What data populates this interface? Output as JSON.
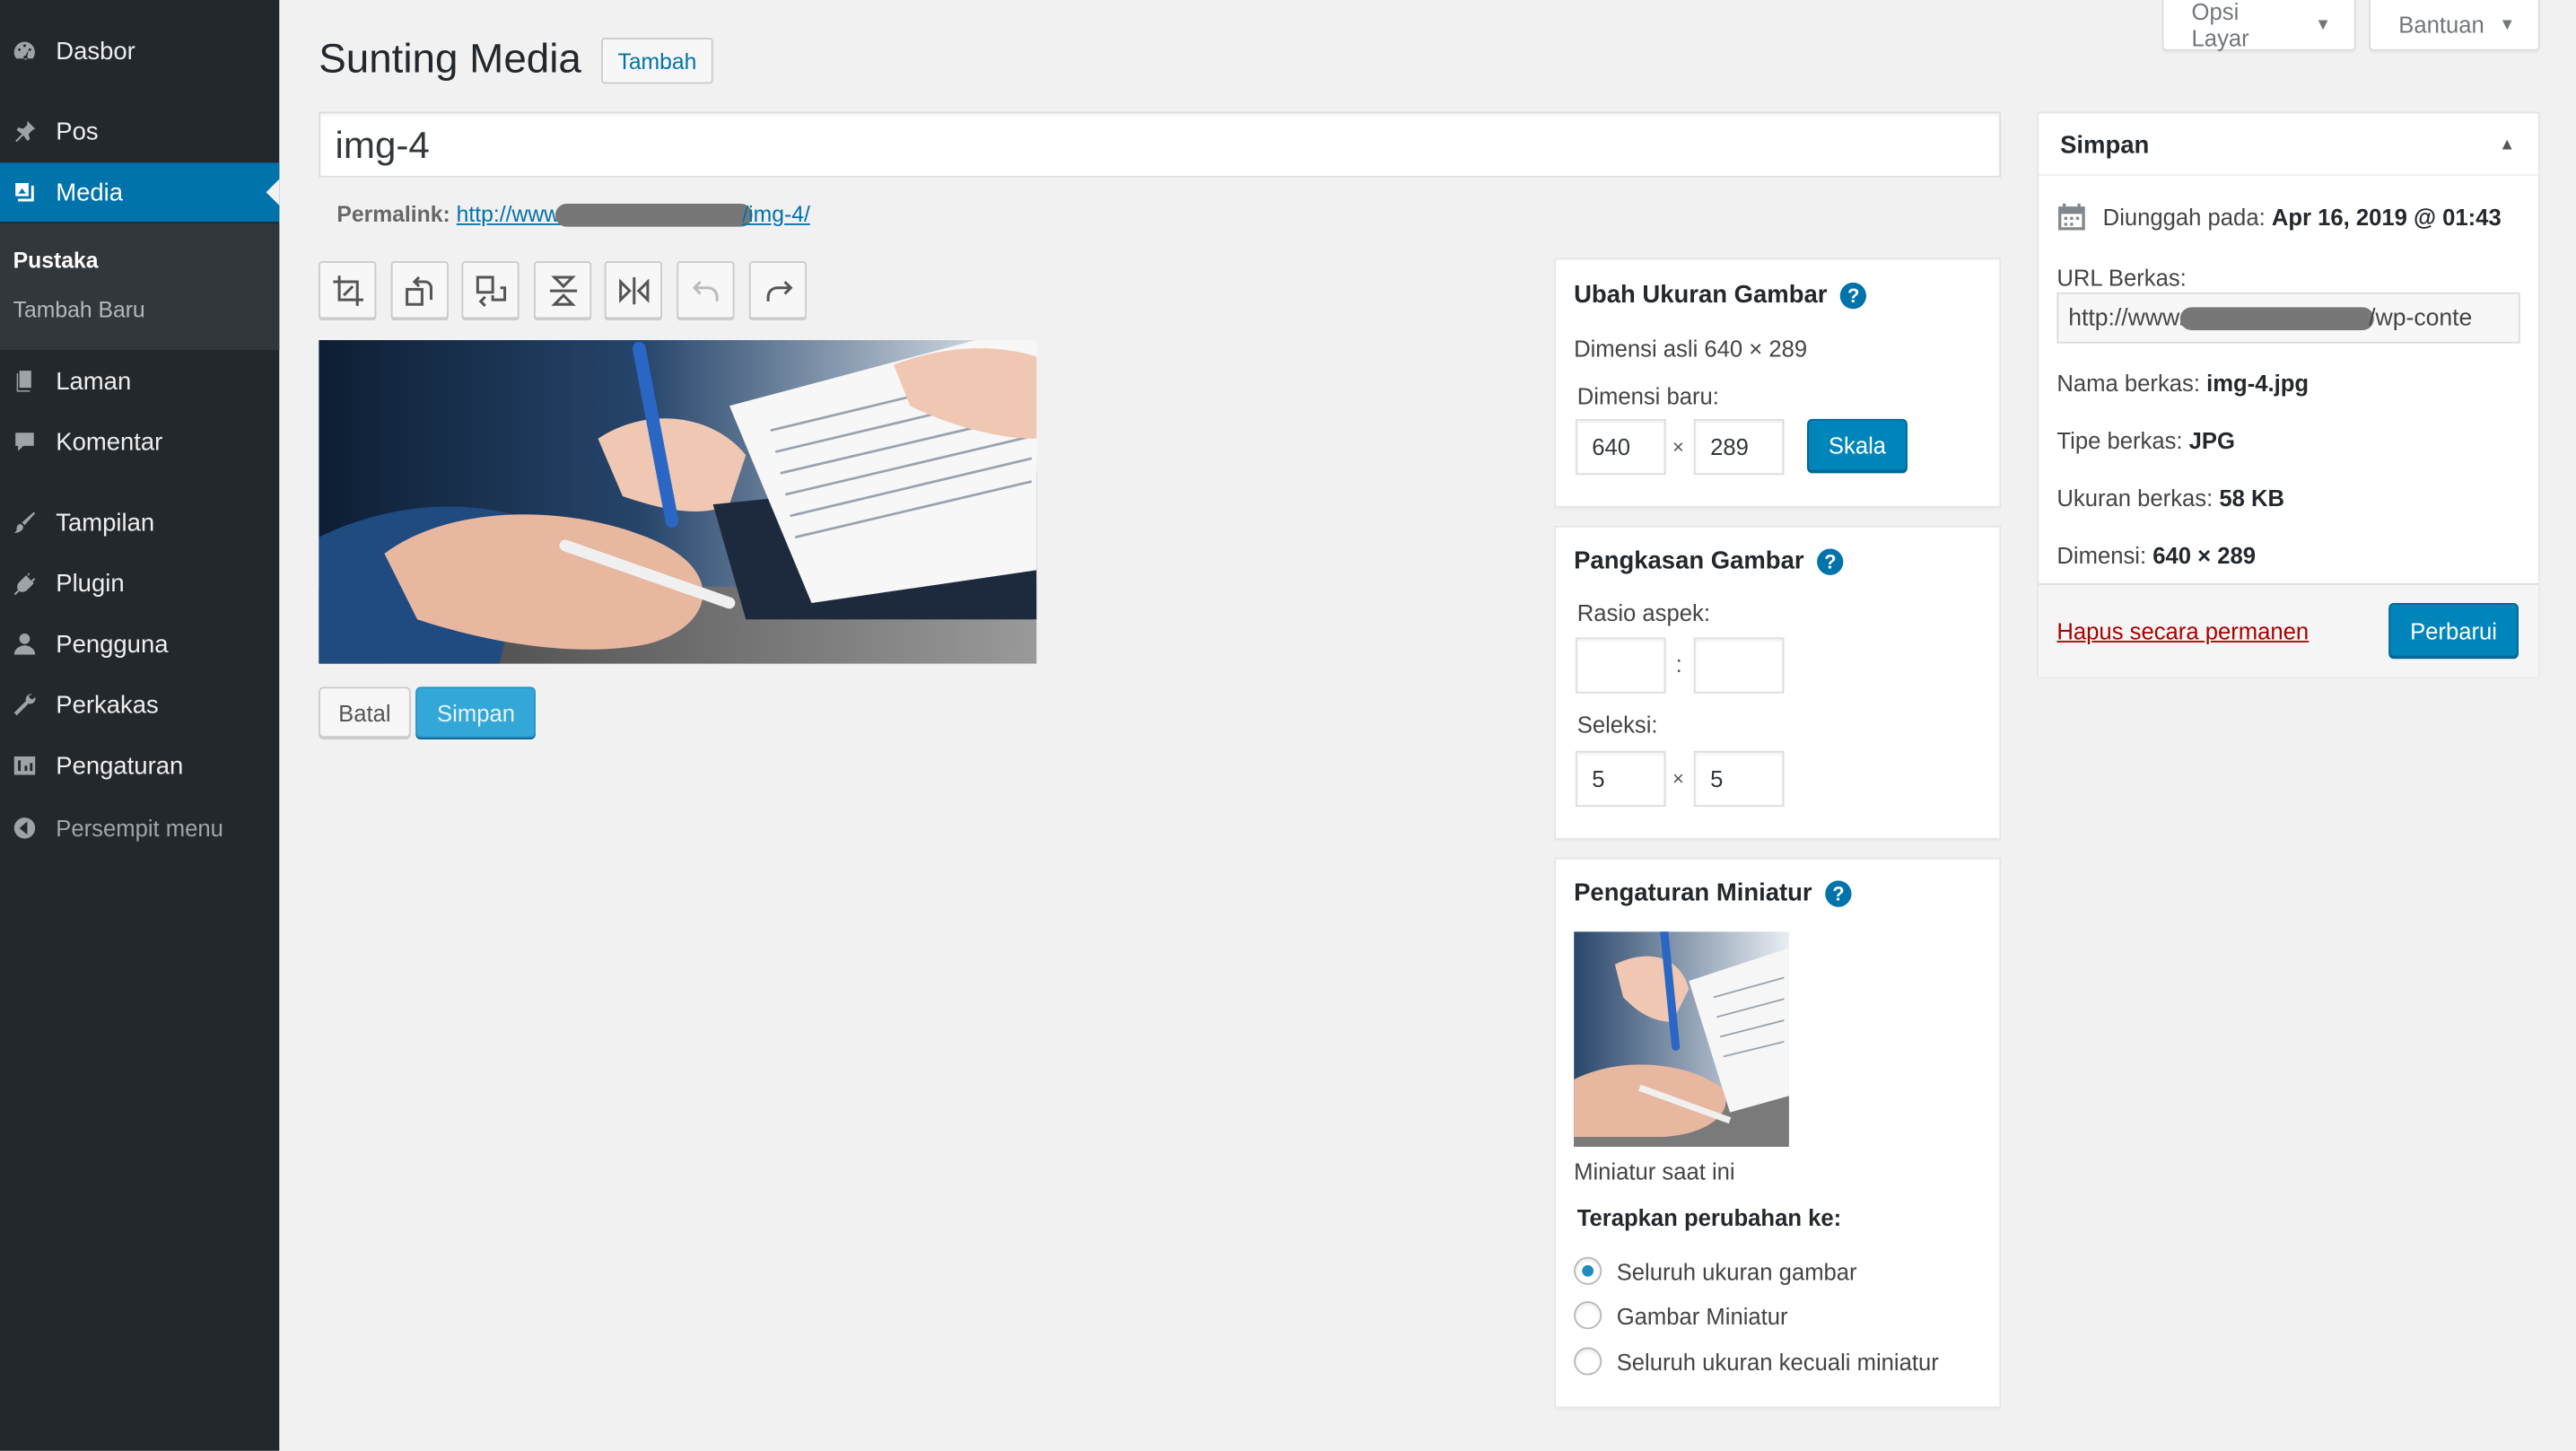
{
  "sidebar": {
    "items": [
      {
        "label": "Dasbor",
        "icon": "dashboard-icon"
      },
      {
        "label": "Pos",
        "icon": "pin-icon"
      },
      {
        "label": "Media",
        "icon": "media-icon"
      },
      {
        "label": "Laman",
        "icon": "page-icon"
      },
      {
        "label": "Komentar",
        "icon": "comment-icon"
      },
      {
        "label": "Tampilan",
        "icon": "brush-icon"
      },
      {
        "label": "Plugin",
        "icon": "plugin-icon"
      },
      {
        "label": "Pengguna",
        "icon": "user-icon"
      },
      {
        "label": "Perkakas",
        "icon": "wrench-icon"
      },
      {
        "label": "Pengaturan",
        "icon": "settings-icon"
      }
    ],
    "submenu": [
      "Pustaka",
      "Tambah Baru"
    ],
    "collapse": "Persempit menu"
  },
  "top": {
    "screen_options": "Opsi Layar",
    "help": "Bantuan"
  },
  "page": {
    "title": "Sunting Media",
    "add_new": "Tambah",
    "post_title": "img-4",
    "permalink_label": "Permalink:",
    "permalink_start": "http://www.",
    "permalink_end": "/img-4/"
  },
  "editor": {
    "cancel": "Batal",
    "save": "Simpan"
  },
  "scale": {
    "title": "Ubah Ukuran Gambar",
    "original": "Dimensi asli 640 × 289",
    "new_label": "Dimensi baru:",
    "width": "640",
    "height": "289",
    "times": "×",
    "button": "Skala"
  },
  "crop": {
    "title": "Pangkasan Gambar",
    "ratio_label": "Rasio aspek:",
    "ratio_sep": ":",
    "selection_label": "Seleksi:",
    "sel_w": "5",
    "sel_h": "5",
    "times": "×"
  },
  "thumb": {
    "title": "Pengaturan Miniatur",
    "current": "Miniatur saat ini",
    "apply_label": "Terapkan perubahan ke:",
    "options": [
      "Seluruh ukuran gambar",
      "Gambar Miniatur",
      "Seluruh ukuran kecuali miniatur"
    ]
  },
  "save_box": {
    "title": "Simpan",
    "uploaded_label": "Diunggah pada:",
    "uploaded_value": "Apr 16, 2019 @ 01:43",
    "url_label": "URL Berkas:",
    "url_start": "http://www.",
    "url_end": "/wp-conte",
    "filename_label": "Nama berkas:",
    "filename_value": "img-4.jpg",
    "filetype_label": "Tipe berkas:",
    "filetype_value": "JPG",
    "filesize_label": "Ukuran berkas:",
    "filesize_value": "58 KB",
    "dimension_label": "Dimensi:",
    "dimension_value": "640 × 289",
    "delete": "Hapus secara permanen",
    "update": "Perbarui"
  },
  "colors": {
    "sidebar": "#23282d",
    "accent": "#0073aa",
    "primary_button": "#0085ba",
    "delete_link": "#a00000"
  }
}
